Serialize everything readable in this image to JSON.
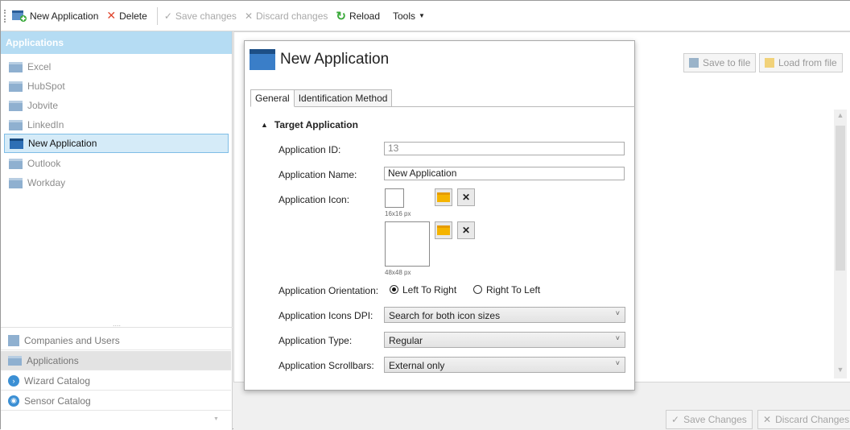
{
  "toolbar": {
    "new_application": "New Application",
    "delete": "Delete",
    "save_changes": "Save changes",
    "discard_changes": "Discard changes",
    "reload": "Reload",
    "tools": "Tools"
  },
  "sidebar": {
    "header": "Applications",
    "apps": [
      {
        "label": "Excel"
      },
      {
        "label": "HubSpot"
      },
      {
        "label": "Jobvite"
      },
      {
        "label": "LinkedIn"
      },
      {
        "label": "New Application"
      },
      {
        "label": "Outlook"
      },
      {
        "label": "Workday"
      }
    ],
    "splitter": "....",
    "nav": [
      {
        "label": "Companies and Users"
      },
      {
        "label": "Applications"
      },
      {
        "label": "Wizard Catalog"
      },
      {
        "label": "Sensor Catalog"
      }
    ]
  },
  "right": {
    "save_to_file": "Save to file",
    "load_from_file": "Load from file",
    "save_changes": "Save Changes",
    "discard_changes": "Discard Changes"
  },
  "dialog": {
    "title": "New Application",
    "tabs": [
      "General",
      "Identification Method"
    ],
    "section": "Target Application",
    "app_id_label": "Application ID:",
    "app_id_value": "13",
    "app_name_label": "Application Name:",
    "app_name_value": "New Application",
    "app_icon_label": "Application Icon:",
    "icon_small_caption": "16x16 px",
    "icon_large_caption": "48x48 px",
    "orientation_label": "Application Orientation:",
    "orientation_ltr": "Left To Right",
    "orientation_rtl": "Right To Left",
    "dpi_label": "Application Icons DPI:",
    "dpi_value": "Search for both icon sizes",
    "type_label": "Application Type:",
    "type_value": "Regular",
    "scrollbars_label": "Application Scrollbars:",
    "scrollbars_value": "External only"
  }
}
